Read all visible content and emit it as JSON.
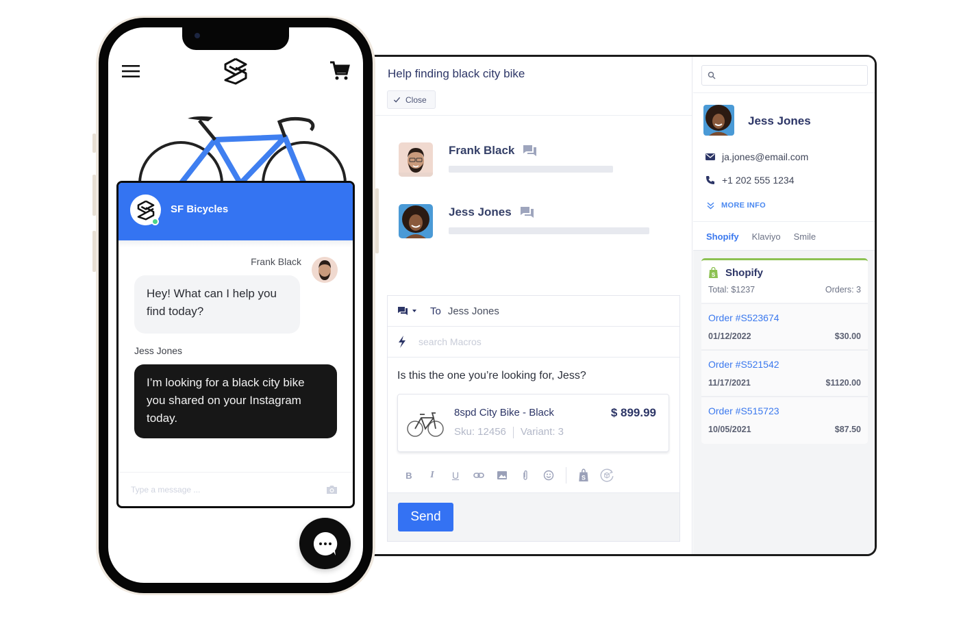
{
  "phone": {
    "store": {
      "menu_icon": "hamburger-menu-icon",
      "logo_icon": "sf-bicycles-logo-icon",
      "cart_icon": "shopping-cart-icon",
      "hero_image": "blue-road-bike"
    },
    "chat": {
      "brand_name": "SF Bicycles",
      "status": "online",
      "messages": [
        {
          "sender": "Frank Black",
          "role": "agent",
          "text": "Hey! What can I help you find today?"
        },
        {
          "sender": "Jess Jones",
          "role": "customer",
          "text": "I’m looking for a black city bike you shared on your Instagram today."
        }
      ],
      "input_placeholder": "Type a message ...",
      "camera_icon": "camera-icon",
      "fab_icon": "chat-bubble-icon"
    }
  },
  "ticket": {
    "title": "Help finding black city bike",
    "close_label": "Close",
    "participants": [
      {
        "name": "Frank Black",
        "icon": "chat-icon"
      },
      {
        "name": "Jess Jones",
        "icon": "chat-icon"
      }
    ],
    "composer": {
      "channel_icon": "chat-channel-icon",
      "to_label": "To",
      "to_name": "Jess Jones",
      "macros_placeholder": "search Macros",
      "message": "Is this the one you’re looking for, Jess?",
      "product": {
        "title": "8spd City Bike - Black",
        "price": "$ 899.99",
        "sku": "Sku: 12456",
        "variant": "Variant: 3"
      },
      "toolbar": [
        "bold",
        "italic",
        "underline",
        "link",
        "image",
        "attachment",
        "emoji",
        "shopify",
        "product-return"
      ],
      "send_label": "Send"
    }
  },
  "sidebar": {
    "search_placeholder": "",
    "customer": {
      "name": "Jess Jones",
      "email": "ja.jones@email.com",
      "phone": "+1 202 555 1234",
      "more_info_label": "MORE INFO"
    },
    "tabs": [
      {
        "label": "Shopify",
        "active": true
      },
      {
        "label": "Klaviyo",
        "active": false
      },
      {
        "label": "Smile",
        "active": false
      }
    ],
    "shopify": {
      "title": "Shopify",
      "total": "Total: $1237",
      "orders_count": "Orders: 3",
      "orders": [
        {
          "id": "Order #S523674",
          "date": "01/12/2022",
          "amount": "$30.00"
        },
        {
          "id": "Order #S521542",
          "date": "11/17/2021",
          "amount": "$1120.00"
        },
        {
          "id": "Order #S515723",
          "date": "10/05/2021",
          "amount": "$87.50"
        }
      ]
    }
  },
  "colors": {
    "brand_blue": "#3474f2",
    "navy_text": "#2c3566",
    "link_blue": "#3a78ee",
    "shopify_green": "#8cc152",
    "online_green": "#4cd38a"
  }
}
